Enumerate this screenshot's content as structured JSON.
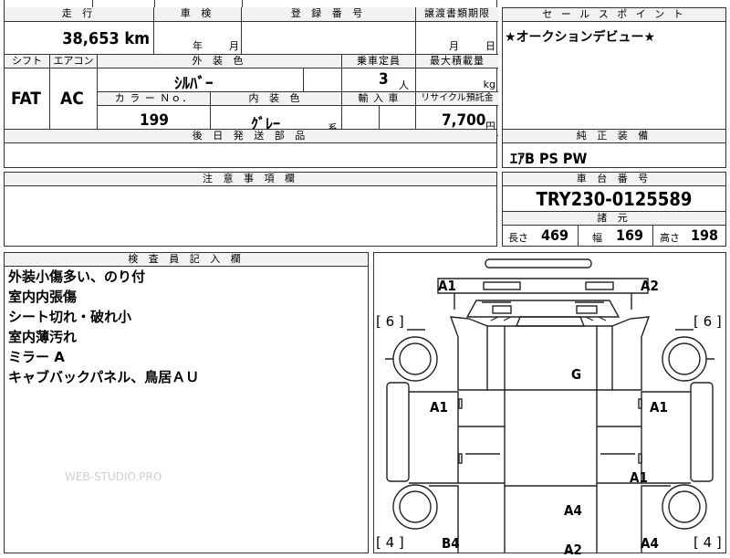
{
  "vehicle": {
    "mileage_header": "走 行",
    "mileage_value": "38,653 km",
    "inspection_header": "車 検",
    "inspection_year_unit": "年",
    "inspection_month_unit": "月",
    "registration_header": "登 録 番 号",
    "transfer_header": "譲渡書類期限",
    "transfer_month_unit": "月",
    "transfer_day_unit": "日",
    "shift_header": "シフト",
    "shift_value": "FAT",
    "ac_header": "エアコン",
    "ac_value": "AC",
    "exterior_color_header": "外 装 色",
    "exterior_color_value": "ｼﾙﾊﾞｰ",
    "capacity_header": "乗車定員",
    "capacity_value": "3",
    "capacity_unit": "人",
    "max_load_header": "最大積載量",
    "max_load_unit": "kg",
    "color_no_header": "カ ラ ー Ｎｏ．",
    "color_no_value": "199",
    "interior_color_header": "内 装 色",
    "interior_color_value": "ｸﾞﾚｰ",
    "interior_suffix": "系",
    "import_header": "輸 入 車",
    "recycle_header": "リサイクル預託金",
    "recycle_value": "7,700",
    "recycle_unit": "円"
  },
  "sales_point": {
    "header": "セ ー ル ス ポ イ ン ト",
    "text": "★オークションデビュー★"
  },
  "later_parts": {
    "header": "後 日 発 送 部 品"
  },
  "standard_equipment": {
    "header": "純 正 装 備",
    "value": "ｴｱB PS PW"
  },
  "notes": {
    "header": "注 意 事 項 欄"
  },
  "chassis": {
    "header": "車 台 番 号",
    "value": "TRY230-0125589"
  },
  "specs": {
    "header": "諸 元",
    "length_label": "長さ",
    "length_value": "469",
    "width_label": "幅",
    "width_value": "169",
    "height_label": "高さ",
    "height_value": "198"
  },
  "inspector": {
    "header": "検 査 員 記 入 欄",
    "lines": [
      "外装小傷多い、のり付",
      "室内内張傷",
      "シート切れ・破れ小",
      "室内薄汚れ",
      "ミラー A",
      "キャブバックパネル、鳥居ＡＵ"
    ]
  },
  "watermark": "WEB-STUDIO.PRO",
  "diagram": {
    "tire_front_left": "[ 6 ]",
    "tire_front_right": "[ 6 ]",
    "tire_rear_left": "[ 4 ]",
    "tire_rear_right": "[ 4 ]",
    "marks": {
      "a1_front_left": "A1",
      "a2_front_right": "A2",
      "g_windshield": "G",
      "a1_left_door": "A1",
      "a1_right_door": "A1",
      "a1_right_bed": "A1",
      "a4_bed": "A4",
      "b4_rear_left": "B4",
      "a2_rear": "A2",
      "a4_rear_right": "A4"
    }
  }
}
